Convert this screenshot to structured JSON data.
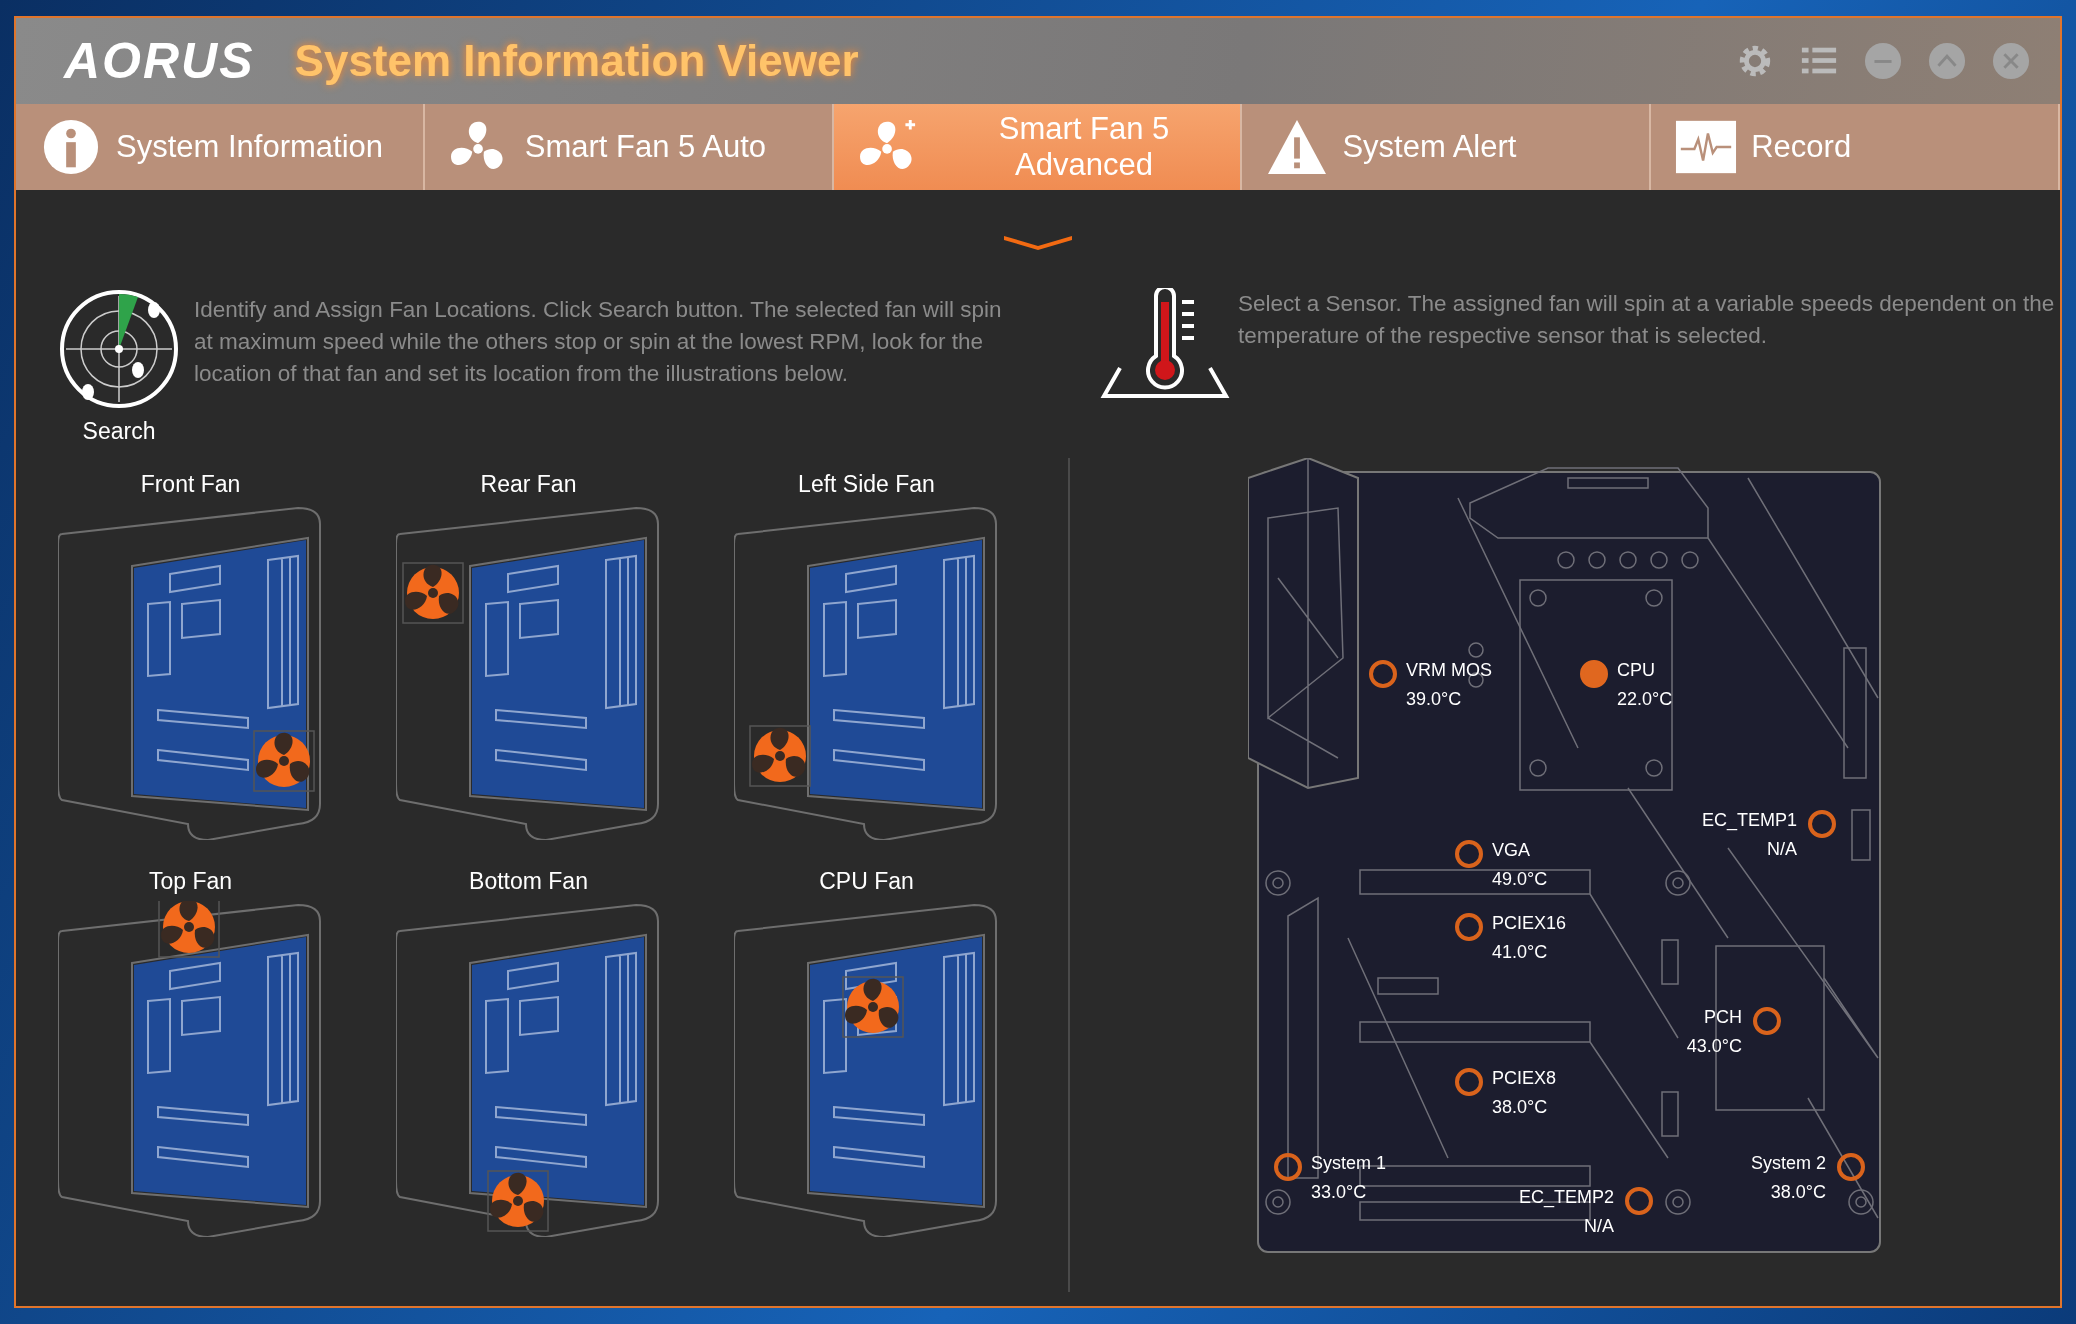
{
  "window": {
    "logo": "AORUS",
    "title": "System Information Viewer"
  },
  "tabs": [
    {
      "label": "System Information",
      "selected": false
    },
    {
      "label": "Smart Fan 5 Auto",
      "selected": false
    },
    {
      "label": "Smart Fan 5 Advanced",
      "selected": true
    },
    {
      "label": "System Alert",
      "selected": false
    },
    {
      "label": "Record",
      "selected": false
    }
  ],
  "fan_panel": {
    "search_label": "Search",
    "instructions": "Identify and Assign Fan Locations. Click Search button. The selected fan will spin at maximum speed while the others stop or spin at the lowest RPM, look for the location of that fan and set its location from the illustrations below.",
    "fans": [
      {
        "label": "Front Fan"
      },
      {
        "label": "Rear Fan"
      },
      {
        "label": "Left Side Fan"
      },
      {
        "label": "Top Fan"
      },
      {
        "label": "Bottom Fan"
      },
      {
        "label": "CPU Fan"
      }
    ]
  },
  "sensor_panel": {
    "instructions": "Select a Sensor. The assigned fan will spin at a variable speeds dependent on the temperature of the respective sensor that is selected.",
    "sensors": [
      {
        "name": "VRM MOS",
        "reading": "39.0°C",
        "selected": false
      },
      {
        "name": "CPU",
        "reading": "22.0°C",
        "selected": true
      },
      {
        "name": "EC_TEMP1",
        "reading": "N/A",
        "selected": false
      },
      {
        "name": "VGA",
        "reading": "49.0°C",
        "selected": false
      },
      {
        "name": "PCIEX16",
        "reading": "41.0°C",
        "selected": false
      },
      {
        "name": "PCH",
        "reading": "43.0°C",
        "selected": false
      },
      {
        "name": "PCIEX8",
        "reading": "38.0°C",
        "selected": false
      },
      {
        "name": "System 1",
        "reading": "33.0°C",
        "selected": false
      },
      {
        "name": "System 2",
        "reading": "38.0°C",
        "selected": false
      },
      {
        "name": "EC_TEMP2",
        "reading": "N/A",
        "selected": false
      }
    ]
  }
}
